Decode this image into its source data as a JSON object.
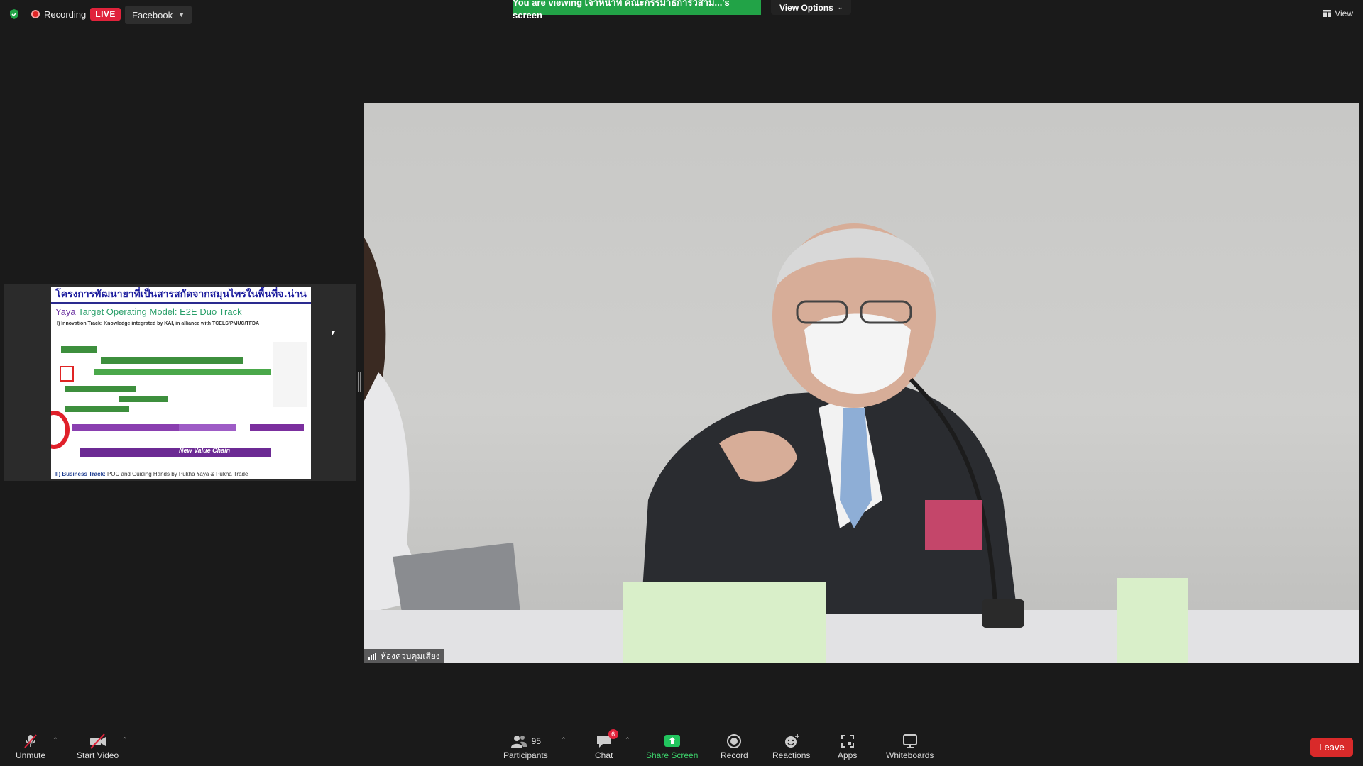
{
  "topbar": {
    "recording_label": "Recording",
    "live_badge": "LIVE",
    "stream_target": "Facebook",
    "viewing_banner": "You are viewing เจ้าหน้าที่ คณะกรรมาธิการวิสาม...'s screen",
    "view_options_label": "View Options",
    "view_label": "View"
  },
  "shared_screen": {
    "slide_title": "โครงการพัฒนายาที่เป็นสารสกัดจากสมุนไพรในพื้นที่จ.น่าน",
    "slide_subtitle_prefix": "Yaya",
    "slide_subtitle": "Target Operating Model: E2E Duo Track",
    "innovation_track": "I) Innovation Track: Knowledge integrated by KAI, in alliance with TCELS/PMUC/TFDA",
    "value_chain_label": "New Value Chain",
    "business_track_prefix": "II) Business Track:",
    "business_track": "POC and Guiding Hands by Pukha Yaya & Pukha Trade"
  },
  "main_video": {
    "participant_name": "ห้องควบคุมเสียง"
  },
  "toolbar": {
    "unmute_label": "Unmute",
    "start_video_label": "Start Video",
    "participants_label": "Participants",
    "participants_count": "95",
    "chat_label": "Chat",
    "chat_badge": "6",
    "share_screen_label": "Share Screen",
    "record_label": "Record",
    "reactions_label": "Reactions",
    "apps_label": "Apps",
    "whiteboards_label": "Whiteboards",
    "leave_label": "Leave"
  },
  "colors": {
    "live_red": "#e0233b",
    "share_green": "#22a347",
    "leave_red": "#d92a2a",
    "background": "#1a1a1a"
  },
  "icons": [
    "shield-icon",
    "record-dot-icon",
    "chevron-down-icon",
    "grid-view-icon",
    "signal-icon",
    "microphone-muted-icon",
    "video-off-icon",
    "participants-icon",
    "chat-icon",
    "share-screen-icon",
    "record-icon",
    "reactions-icon",
    "apps-icon",
    "whiteboard-icon"
  ]
}
